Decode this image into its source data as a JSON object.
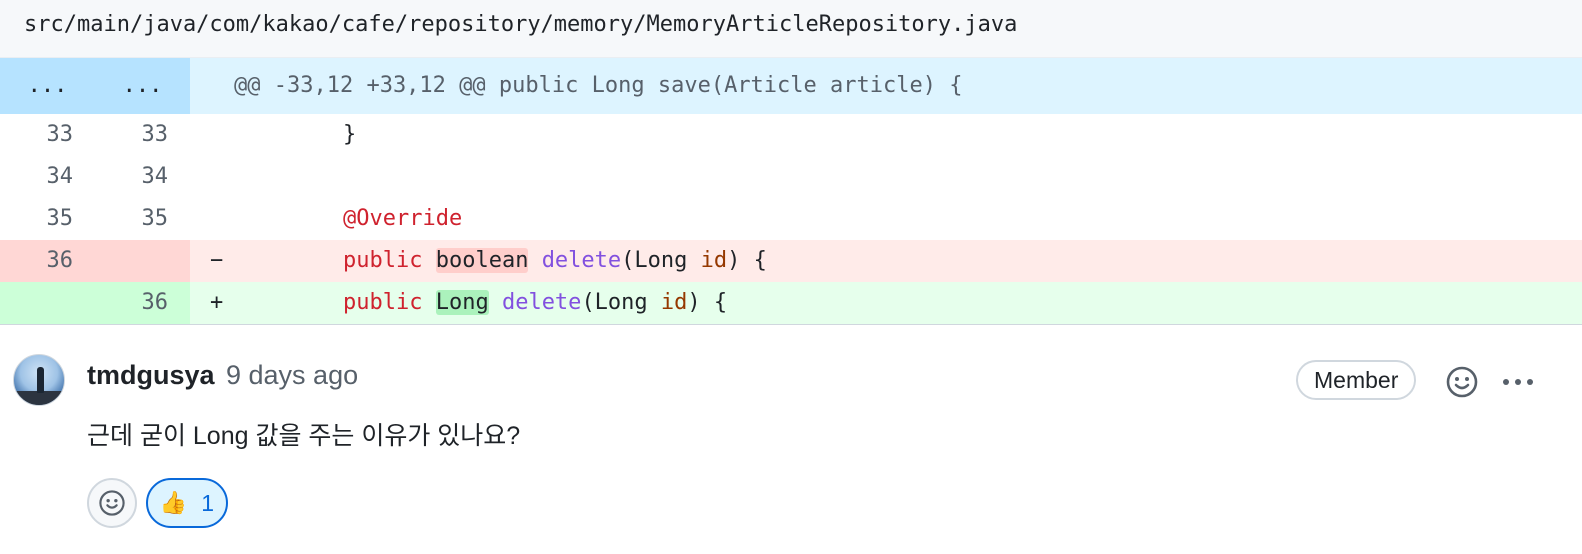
{
  "file": {
    "path": "src/main/java/com/kakao/cafe/repository/memory/MemoryArticleRepository.java"
  },
  "diff": {
    "hunk": {
      "left": "...",
      "right": "...",
      "header": "@@ -33,12 +33,12 @@ public Long save(Article article) {"
    },
    "lines": [
      {
        "type": "context",
        "old": "33",
        "new": "33",
        "marker": "",
        "code": "    }"
      },
      {
        "type": "context",
        "old": "34",
        "new": "34",
        "marker": "",
        "code": ""
      },
      {
        "type": "context",
        "old": "35",
        "new": "35",
        "marker": "",
        "code": "@Override"
      },
      {
        "type": "del",
        "old": "36",
        "new": "",
        "marker": "−",
        "tokens": [
          "public",
          "boolean",
          "delete",
          "(Long ",
          "id",
          ") {"
        ]
      },
      {
        "type": "add",
        "old": "",
        "new": "36",
        "marker": "+",
        "tokens": [
          "public",
          "Long",
          "delete",
          "(Long ",
          "id",
          ") {"
        ]
      }
    ]
  },
  "comment": {
    "author": "tmdgusya",
    "time": "9 days ago",
    "badge": "Member",
    "body": "근데 굳이 Long 값을 주는 이유가 있나요?",
    "reaction": {
      "emoji": "👍",
      "count": "1"
    }
  },
  "icons": {
    "avatar": "avatar-image",
    "smiley": "smiley-icon",
    "more": "kebab-horizontal-icon"
  }
}
